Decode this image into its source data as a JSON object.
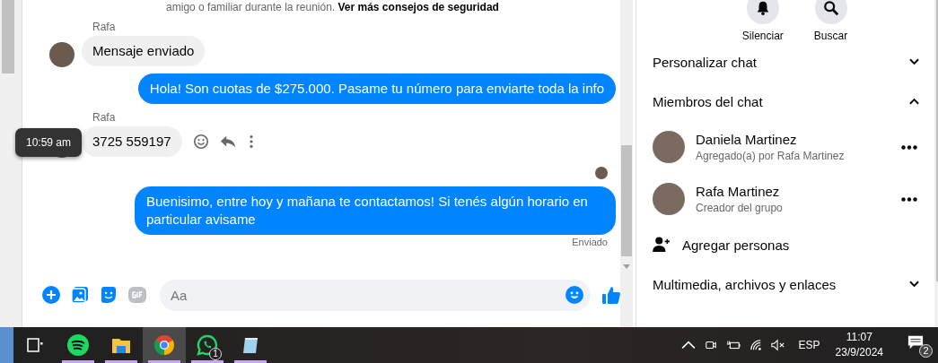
{
  "chat": {
    "notice": "amigo o familiar durante la reunión. **Ver más consejos de seguridad**",
    "messages": [
      {
        "kind": "incoming",
        "sender": "Rafa",
        "text": "Mensaje enviado"
      },
      {
        "kind": "outgoing",
        "text": "Hola! Son cuotas de $275.000. Pasame tu número para enviarte toda la info"
      },
      {
        "kind": "incoming",
        "sender": "Rafa",
        "text": "3725  559197",
        "tooltip": "10:59 am"
      },
      {
        "kind": "seen"
      },
      {
        "kind": "outgoing",
        "text": "Buenisimo, entre hoy y mañana te contactamos! Si tenés algún horario en particular avisame",
        "status": "Enviado"
      }
    ],
    "composer": {
      "placeholder": "Aa"
    }
  },
  "details": {
    "actions": [
      {
        "label": "Silenciar"
      },
      {
        "label": "Buscar"
      }
    ],
    "sections": [
      {
        "title": "Personalizar chat",
        "expanded": false
      },
      {
        "title": "Miembros del chat",
        "expanded": true,
        "members": [
          {
            "name": "Daniela Martinez",
            "note": "Agregado(a) por Rafa Martinez"
          },
          {
            "name": "Rafa Martinez",
            "note": "Creador del grupo"
          }
        ],
        "add_label": "Agregar personas"
      },
      {
        "title": "Multimedia, archivos y enlaces",
        "expanded": false
      }
    ]
  },
  "taskbar": {
    "apps": [
      {
        "kind": "taskview",
        "selected": false,
        "running": false
      },
      {
        "kind": "spotify",
        "selected": false,
        "running": true
      },
      {
        "kind": "files",
        "selected": false,
        "running": true
      },
      {
        "kind": "chrome",
        "selected": true,
        "running": true
      },
      {
        "kind": "whatsapp",
        "selected": false,
        "running": true,
        "badge": "1"
      },
      {
        "kind": "notepad",
        "selected": false,
        "running": true
      }
    ],
    "language": "ESP",
    "time": "11:07",
    "date": "23/9/2024",
    "notifications": "2"
  }
}
